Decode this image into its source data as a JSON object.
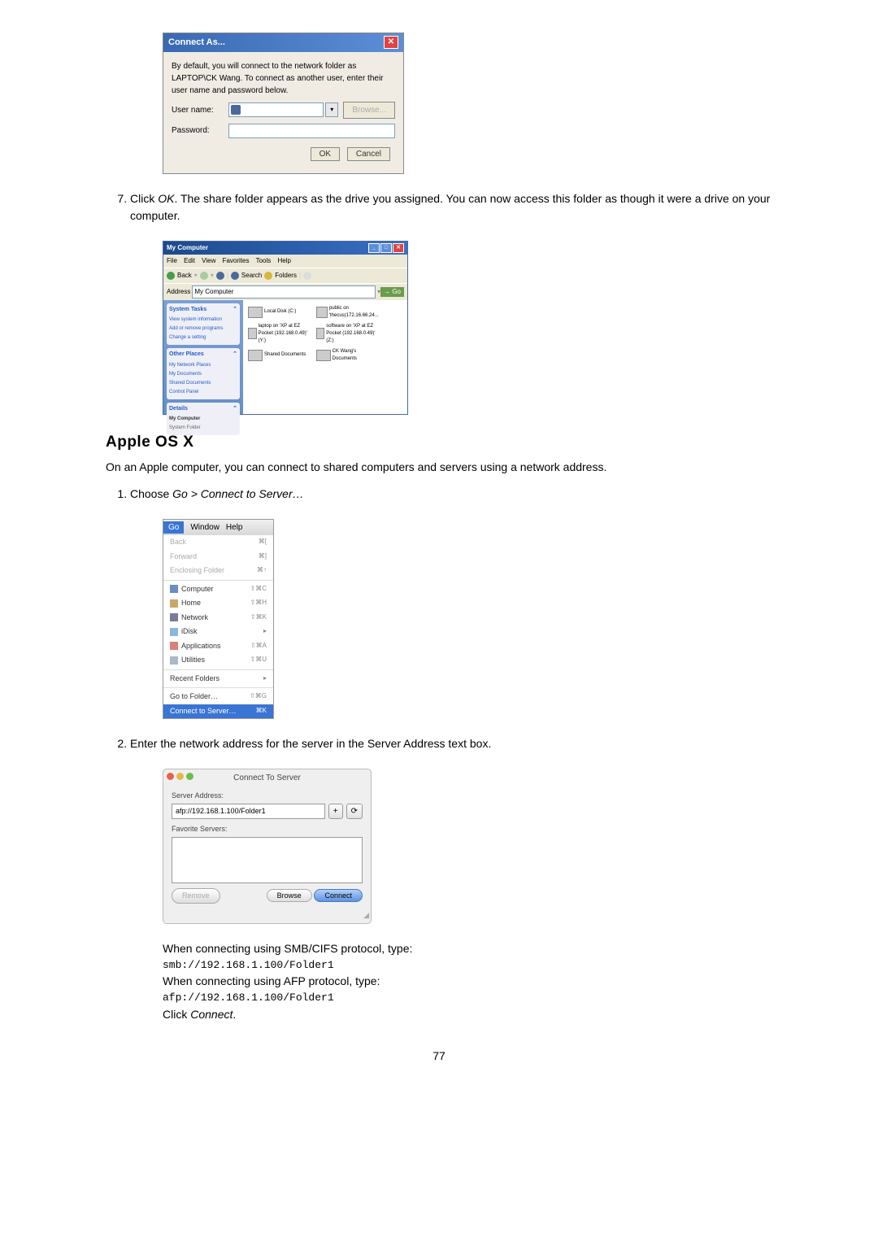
{
  "connect_as_dialog": {
    "title": "Connect As...",
    "desc": "By default, you will connect to the network folder as LAPTOP\\CK Wang. To connect as another user, enter their user name and password below.",
    "username_label": "User name:",
    "password_label": "Password:",
    "browse_btn": "Browse...",
    "ok_btn": "OK",
    "cancel_btn": "Cancel"
  },
  "step7": {
    "text_a": "Click ",
    "text_b": "OK",
    "text_c": ". The share folder appears as the drive you assigned. You can now access this folder as though it were a drive on your computer."
  },
  "explorer": {
    "title": "My Computer",
    "menu": {
      "file": "File",
      "edit": "Edit",
      "view": "View",
      "favorites": "Favorites",
      "tools": "Tools",
      "help": "Help"
    },
    "toolbar": {
      "back": "Back",
      "search": "Search",
      "folders": "Folders"
    },
    "address_label": "Address",
    "address_value": "My Computer",
    "go": "Go",
    "sidebar": {
      "system_tasks": "System Tasks",
      "view_system": "View system information",
      "add_remove": "Add or remove programs",
      "change_setting": "Change a setting",
      "other_places": "Other Places",
      "network_places": "My Network Places",
      "my_documents": "My Documents",
      "shared_docs": "Shared Documents",
      "control_panel": "Control Panel",
      "details": "Details",
      "mycomputer": "My Computer",
      "system_folder": "System Folder"
    },
    "drives": {
      "local": "Local Disk (C:)",
      "public": "public on 'thecus(172.16.66.24...",
      "laptop": "laptop on 'XP at EZ Pocket (192.168.0.49)' (Y:)",
      "software": "software on 'XP at EZ Pocket (192.168.0.49)' (Z:)",
      "shared": "Shared Documents",
      "ck": "CK Wang's Documents"
    }
  },
  "apple_heading": "Apple OS X",
  "apple_intro": "On an Apple computer, you can connect to shared computers and servers using a network address.",
  "step1": {
    "text_a": "Choose ",
    "text_b": "Go > Connect to Server…"
  },
  "mac_menu": {
    "go": "Go",
    "window": "Window",
    "help": "Help",
    "back": "Back",
    "forward": "Forward",
    "enclosing": "Enclosing Folder",
    "computer": "Computer",
    "home": "Home",
    "network": "Network",
    "idisk": "iDisk",
    "applications": "Applications",
    "utilities": "Utilities",
    "recent": "Recent Folders",
    "goto": "Go to Folder…",
    "connect": "Connect to Server…",
    "sc_back": "⌘[",
    "sc_forward": "⌘]",
    "sc_enclosing": "⌘↑",
    "sc_computer": "⇧⌘C",
    "sc_home": "⇧⌘H",
    "sc_network": "⇧⌘K",
    "sc_idisk": "▸",
    "sc_applications": "⇧⌘A",
    "sc_utilities": "⇧⌘U",
    "sc_recent": "▸",
    "sc_goto": "⇧⌘G",
    "sc_connect": "⌘K"
  },
  "step2": "Enter the network address for the server in the Server Address text box.",
  "connect_server": {
    "title": "Connect To Server",
    "server_address_label": "Server Address:",
    "address_value": "afp://192.168.1.100/Folder1",
    "plus": "+",
    "clock": "⟳",
    "favorite_label": "Favorite Servers:",
    "remove": "Remove",
    "browse": "Browse",
    "connect": "Connect"
  },
  "footer": {
    "smb_text": "When connecting using SMB/CIFS protocol, type:",
    "smb_code": "smb://192.168.1.100/Folder1",
    "afp_text": "When connecting using AFP protocol, type:",
    "afp_code": "afp://192.168.1.100/Folder1",
    "click_a": "Click ",
    "click_b": "Connect",
    "click_c": "."
  },
  "page_number": "77"
}
